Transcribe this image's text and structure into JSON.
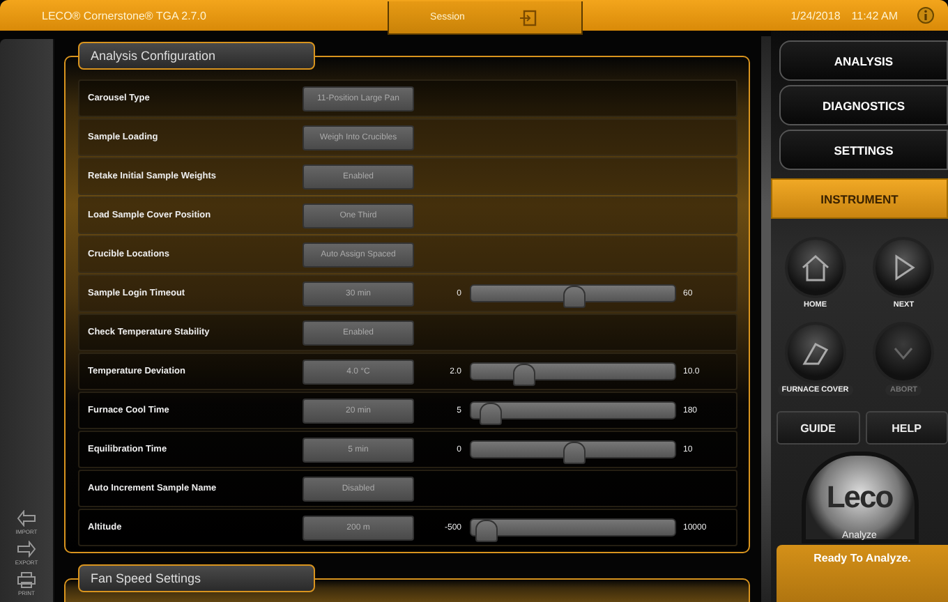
{
  "title_bar": {
    "app": "LECO® Cornerstone® TGA 2.7.0",
    "session": "Session",
    "date": "1/24/2018",
    "time": "11:42 AM"
  },
  "left_bar": [
    {
      "kind": "import",
      "label": "IMPORT"
    },
    {
      "kind": "export",
      "label": "EXPORT"
    },
    {
      "kind": "print",
      "label": "PRINT"
    }
  ],
  "sections": [
    {
      "title": "Analysis Configuration",
      "rows": [
        {
          "kind": "text",
          "label": "Carousel Type",
          "value": "11-Position Large Pan"
        },
        {
          "kind": "text",
          "label": "Sample Loading",
          "value": "Weigh Into Crucibles"
        },
        {
          "kind": "text",
          "label": "Retake Initial Sample Weights",
          "value": "Enabled"
        },
        {
          "kind": "text",
          "label": "Load Sample Cover Position",
          "value": "One Third"
        },
        {
          "kind": "text",
          "label": "Crucible Locations",
          "value": "Auto Assign Spaced"
        },
        {
          "kind": "slider",
          "label": "Sample Login Timeout",
          "value": "30 min",
          "min": "0",
          "max": "60",
          "level": 0.5
        },
        {
          "kind": "text",
          "label": "Check Temperature Stability",
          "value": "Enabled"
        },
        {
          "kind": "slider",
          "label": "Temperature Deviation",
          "value": "4.0 °C",
          "min": "2.0",
          "max": "10.0",
          "level": 0.25
        },
        {
          "kind": "slider",
          "label": "Furnace Cool Time",
          "value": "20 min",
          "min": "5",
          "max": "180",
          "level": 0.09
        },
        {
          "kind": "slider",
          "label": "Equilibration Time",
          "value": "5 min",
          "min": "0",
          "max": "10",
          "level": 0.5
        },
        {
          "kind": "text",
          "label": "Auto Increment Sample Name",
          "value": "Disabled"
        },
        {
          "kind": "slider",
          "label": "Altitude",
          "value": "200 m",
          "min": "-500",
          "max": "10000",
          "level": 0.07
        }
      ]
    },
    {
      "title": "Fan Speed Settings"
    }
  ],
  "nav": [
    {
      "label": "ANALYSIS",
      "selected": false
    },
    {
      "label": "DIAGNOSTICS",
      "selected": false
    },
    {
      "label": "SETTINGS",
      "selected": false
    },
    {
      "label": "INSTRUMENT",
      "selected": true
    }
  ],
  "round_buttons": [
    {
      "kind": "home",
      "label": "HOME",
      "disabled": false
    },
    {
      "kind": "next",
      "label": "NEXT",
      "disabled": false
    },
    {
      "kind": "cover",
      "label": "FURNACE COVER",
      "disabled": false
    },
    {
      "kind": "abort",
      "label": "ABORT",
      "disabled": true
    }
  ],
  "help_buttons": [
    "GUIDE",
    "HELP"
  ],
  "analyze": {
    "logo": "Leco",
    "label": "Analyze"
  },
  "status": "Ready To Analyze."
}
